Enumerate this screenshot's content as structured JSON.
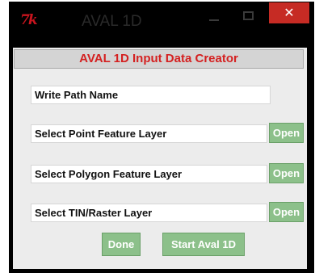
{
  "window": {
    "title": "AVAL 1D",
    "icon_text": "7k",
    "close_symbol": "✕",
    "close_color": "#c62b24"
  },
  "header": {
    "title": "AVAL 1D Input Data Creator",
    "title_color": "#d42020"
  },
  "fields": {
    "write_path": "Write Path Name",
    "point_layer": "Select Point Feature Layer",
    "polygon_layer": "Select Polygon Feature Layer",
    "tin_raster_layer": "Select TIN/Raster Layer"
  },
  "buttons": {
    "open_label": "Open",
    "done_label": "Done",
    "start_label": "Start Aval 1D",
    "button_color": "#8cc08a"
  }
}
